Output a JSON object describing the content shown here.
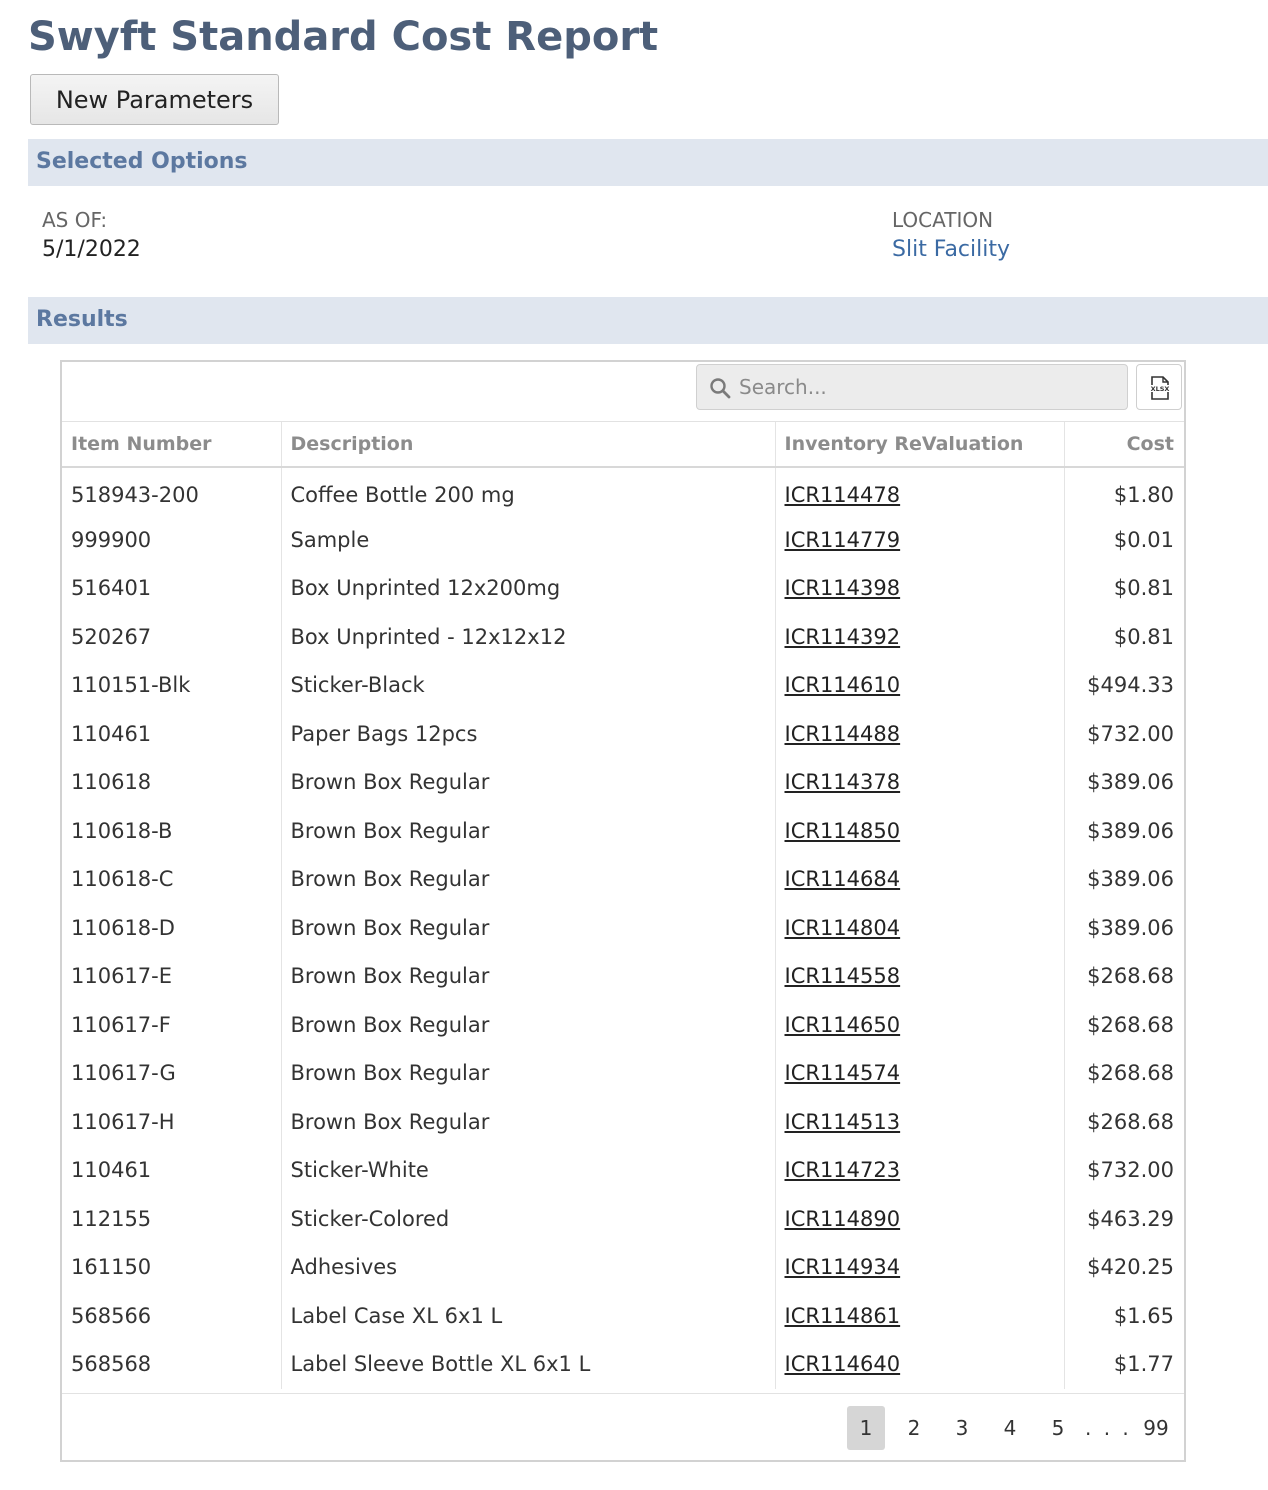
{
  "header": {
    "title": "Swyft Standard Cost Report"
  },
  "toolbar": {
    "new_parameters_label": "New Parameters"
  },
  "selected_options": {
    "section_title": "Selected Options",
    "as_of": {
      "label": "AS OF:",
      "value": "5/1/2022"
    },
    "location": {
      "label": "LOCATION",
      "value": "Slit Facility"
    }
  },
  "results": {
    "section_title": "Results",
    "search": {
      "placeholder": "Search...",
      "value": ""
    },
    "export_icon": "xlsx-export-icon",
    "columns": [
      "Item Number",
      "Description",
      "Inventory ReValuation",
      "Cost"
    ],
    "rows": [
      {
        "item": "518943-200",
        "description": "Coffee Bottle 200 mg",
        "revaluation": "ICR114478",
        "cost": "$1.80"
      },
      {
        "item": "999900",
        "description": "Sample",
        "revaluation": "ICR114779",
        "cost": "$0.01"
      },
      {
        "item": "516401",
        "description": "Box Unprinted 12x200mg",
        "revaluation": "ICR114398",
        "cost": "$0.81"
      },
      {
        "item": "520267",
        "description": "Box Unprinted - 12x12x12",
        "revaluation": "ICR114392",
        "cost": "$0.81"
      },
      {
        "item": "110151-Blk",
        "description": "Sticker-Black",
        "revaluation": "ICR114610",
        "cost": "$494.33"
      },
      {
        "item": "110461",
        "description": "Paper Bags 12pcs",
        "revaluation": "ICR114488",
        "cost": "$732.00"
      },
      {
        "item": "110618",
        "description": "Brown Box Regular",
        "revaluation": "ICR114378",
        "cost": "$389.06"
      },
      {
        "item": "110618-B",
        "description": "Brown Box Regular",
        "revaluation": "ICR114850",
        "cost": "$389.06"
      },
      {
        "item": "110618-C",
        "description": "Brown Box Regular",
        "revaluation": "ICR114684",
        "cost": "$389.06"
      },
      {
        "item": "110618-D",
        "description": "Brown Box Regular",
        "revaluation": "ICR114804",
        "cost": "$389.06"
      },
      {
        "item": "110617-E",
        "description": "Brown Box Regular",
        "revaluation": "ICR114558",
        "cost": "$268.68"
      },
      {
        "item": "110617-F",
        "description": "Brown Box Regular",
        "revaluation": "ICR114650",
        "cost": "$268.68"
      },
      {
        "item": "110617-G",
        "description": "Brown Box Regular",
        "revaluation": "ICR114574",
        "cost": "$268.68"
      },
      {
        "item": "110617-H",
        "description": "Brown Box Regular",
        "revaluation": "ICR114513",
        "cost": "$268.68"
      },
      {
        "item": "110461",
        "description": "Sticker-White",
        "revaluation": "ICR114723",
        "cost": "$732.00"
      },
      {
        "item": "112155",
        "description": "Sticker-Colored",
        "revaluation": "ICR114890",
        "cost": "$463.29"
      },
      {
        "item": "161150",
        "description": "Adhesives",
        "revaluation": "ICR114934",
        "cost": "$420.25"
      },
      {
        "item": "568566",
        "description": "Label Case XL 6x1 L",
        "revaluation": "ICR114861",
        "cost": "$1.65"
      },
      {
        "item": "568568",
        "description": "Label Sleeve Bottle XL 6x1 L",
        "revaluation": "ICR114640",
        "cost": "$1.77"
      }
    ],
    "pagination": {
      "pages": [
        "1",
        "2",
        "3",
        "4",
        "5"
      ],
      "ellipsis": ". . .",
      "last_page": "99",
      "current": "1"
    }
  },
  "colors": {
    "title": "#4d5f79",
    "section_bar_bg": "#e0e6ef",
    "section_bar_text": "#5c78a0",
    "link": "#3b6aa3"
  }
}
